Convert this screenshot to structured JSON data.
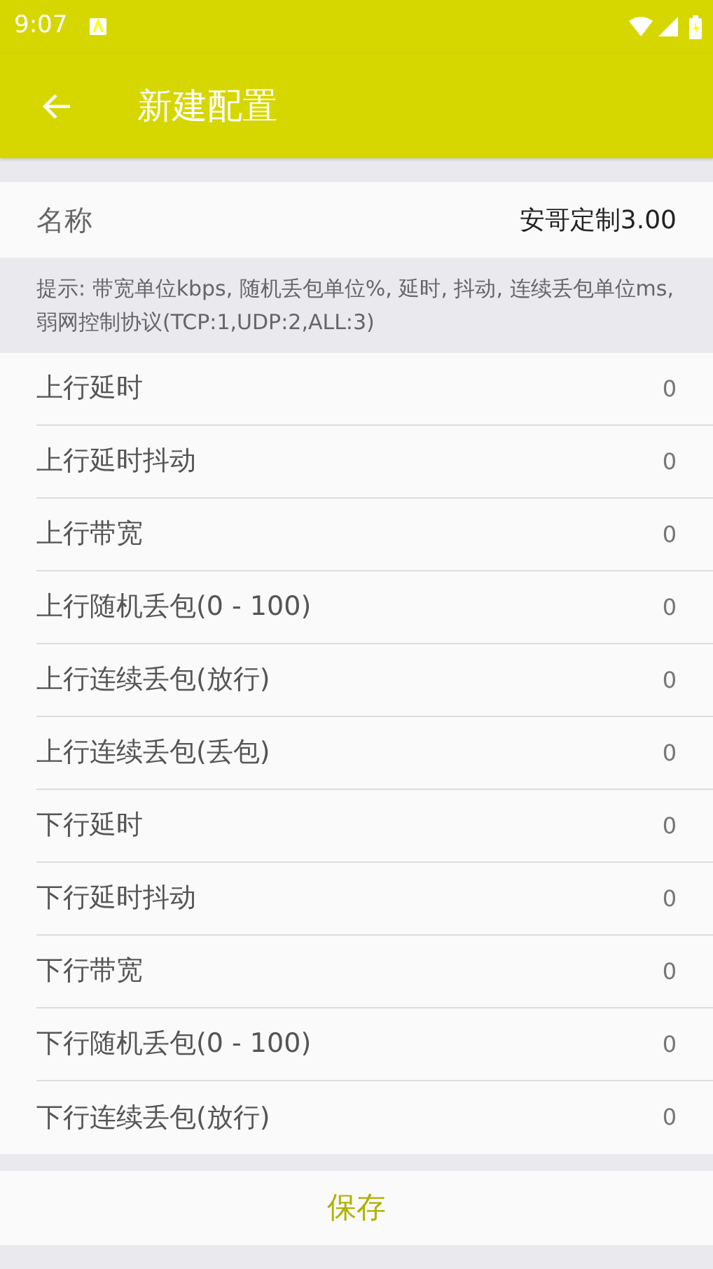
{
  "status_bar": {
    "time": "9:07"
  },
  "toolbar": {
    "title": "新建配置"
  },
  "name_field": {
    "label": "名称",
    "value": "安哥定制3.00"
  },
  "hint": "提示: 带宽单位kbps, 随机丢包单位%, 延时, 抖动, 连续丢包单位ms, 弱网控制协议(TCP:1,UDP:2,ALL:3)",
  "settings": [
    {
      "label": "上行延时",
      "value": "0"
    },
    {
      "label": "上行延时抖动",
      "value": "0"
    },
    {
      "label": "上行带宽",
      "value": "0"
    },
    {
      "label": "上行随机丢包(0 - 100)",
      "value": "0"
    },
    {
      "label": "上行连续丢包(放行)",
      "value": "0"
    },
    {
      "label": "上行连续丢包(丢包)",
      "value": "0"
    },
    {
      "label": "下行延时",
      "value": "0"
    },
    {
      "label": "下行延时抖动",
      "value": "0"
    },
    {
      "label": "下行带宽",
      "value": "0"
    },
    {
      "label": "下行随机丢包(0 - 100)",
      "value": "0"
    },
    {
      "label": "下行连续丢包(放行)",
      "value": "0"
    }
  ],
  "save_button": "保存"
}
